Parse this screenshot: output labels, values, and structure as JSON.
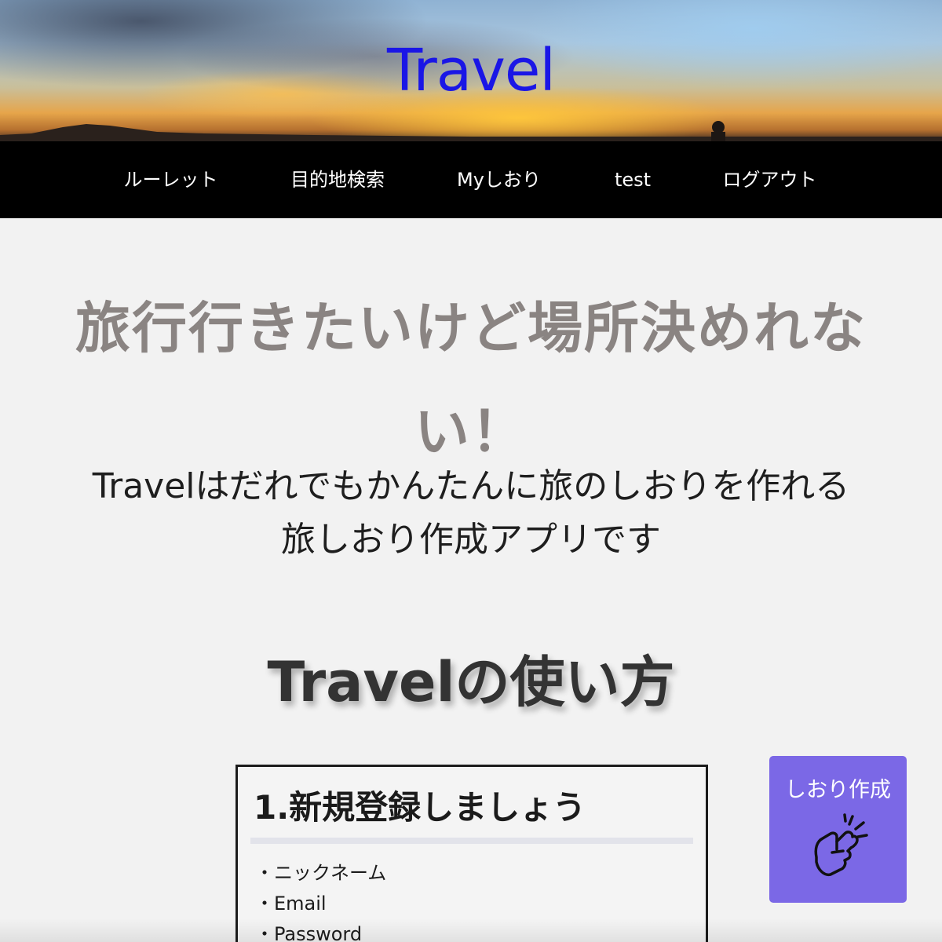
{
  "header": {
    "title": "Travel"
  },
  "nav": {
    "items": [
      {
        "label": "ルーレット"
      },
      {
        "label": "目的地検索"
      },
      {
        "label": "Myしおり"
      },
      {
        "label": "test"
      },
      {
        "label": "ログアウト"
      }
    ]
  },
  "main": {
    "headline": "旅行行きたいけど場所決めれない！",
    "subtext_line1": "Travelはだれでもかんたんに旅のしおりを作れる",
    "subtext_line2": "旅しおり作成アプリです",
    "howto_title": "Travelの使い方"
  },
  "step1": {
    "title": "1.新規登録しましょう",
    "items": [
      "・ニックネーム",
      "・Email",
      "・Password"
    ]
  },
  "create_button": {
    "label": "しおり作成",
    "icon": "finger-snap-icon"
  },
  "colors": {
    "title_blue": "#1a16e6",
    "nav_bg": "#000000",
    "headline_gray": "#8a8482",
    "button_purple": "#7b68e6"
  }
}
